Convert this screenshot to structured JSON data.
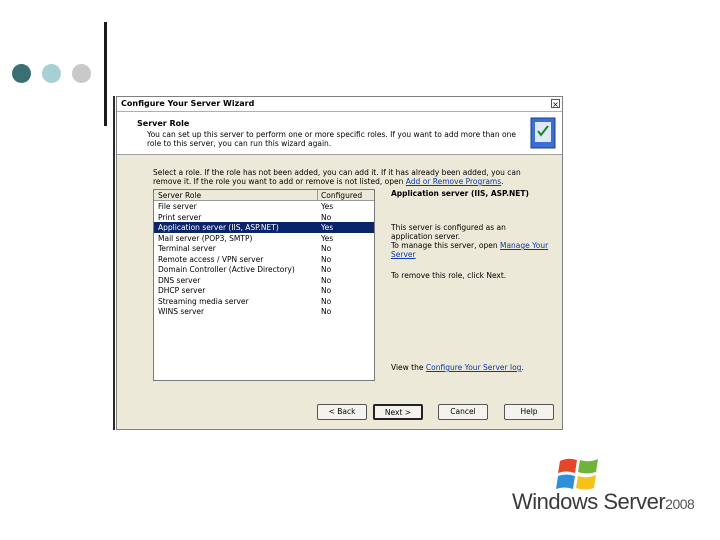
{
  "colors": {
    "dot1": "#3a6f73",
    "dot2": "#a8cfd3",
    "dot3": "#c9c9c9",
    "selection": "#0a246a",
    "link": "#0b3aa8"
  },
  "wizard": {
    "title": "Configure Your Server Wizard",
    "close_symbol": "×",
    "header_title": "Server Role",
    "header_desc": "You can set up this server to perform one or more specific roles. If you want to add more than one role to this server, you can run this wizard again.",
    "instructions_1": "Select a role. If the role has not been added, you can add it. If it has already been added, you can remove it. If the role you want to add or remove is not listed, open",
    "instructions_link": "Add or Remove Programs",
    "instructions_end": ".",
    "table": {
      "col_role": "Server Role",
      "col_configured": "Configured",
      "rows": [
        {
          "role": "File server",
          "configured": "Yes"
        },
        {
          "role": "Print server",
          "configured": "No"
        },
        {
          "role": "Application server (IIS, ASP.NET)",
          "configured": "Yes"
        },
        {
          "role": "Mail server (POP3, SMTP)",
          "configured": "Yes"
        },
        {
          "role": "Terminal server",
          "configured": "No"
        },
        {
          "role": "Remote access / VPN server",
          "configured": "No"
        },
        {
          "role": "Domain Controller (Active Directory)",
          "configured": "No"
        },
        {
          "role": "DNS server",
          "configured": "No"
        },
        {
          "role": "DHCP server",
          "configured": "No"
        },
        {
          "role": "Streaming media server",
          "configured": "No"
        },
        {
          "role": "WINS server",
          "configured": "No"
        }
      ]
    },
    "details": {
      "title": "Application server (IIS, ASP.NET)",
      "configured_text": "This server is configured as an application server.",
      "manage_text": "To manage this server, open",
      "manage_link": "Manage Your Server",
      "remove_text": "To remove this role, click Next."
    },
    "footer_text": "View the",
    "footer_link": "Configure Your Server log",
    "footer_end": ".",
    "buttons": {
      "back": "< Back",
      "next": "Next >",
      "cancel": "Cancel",
      "help": "Help"
    }
  },
  "logo": {
    "main": "Windows Server",
    "version": "2008"
  }
}
